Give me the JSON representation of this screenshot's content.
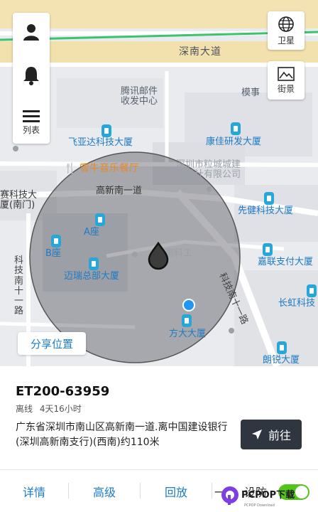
{
  "map": {
    "roads": {
      "shennan": "深南大道",
      "gaoxin": "高新南一道",
      "keji_left": "科技南十一路",
      "keji_right": "科技南十一路"
    },
    "labels": {
      "post": "腾讯邮件收发中心",
      "moshi": "模事",
      "feiyada": "飞亚达科技大厦",
      "kangjia": "康佳研发大厦",
      "restaurant": "雪牛音乐餐厅",
      "shenzhen_co": "深圳市粒城城建筑设计有限公司",
      "saike": "赛科技大厦(南门)",
      "xianjian": "先健科技大厦",
      "a_zuo": "A座",
      "b_zuo": "B座",
      "mairui": "迈瑞总部大厦",
      "jialian": "嘉联支付大厦",
      "changhong": "长虹科技",
      "fangda": "方大大厦",
      "langxin": "朗锐大厦",
      "center_gray": "南科工"
    },
    "controls": {
      "satellite": "卫星",
      "street": "街景",
      "list": "列表"
    },
    "share_label": "分享位置"
  },
  "device": {
    "name": "ET200-63959",
    "status": "离线",
    "duration": "4天16小时",
    "address": "广东省深圳市南山区高新南一道.离中国建设银行(深圳高新南支行)(西南)约110米",
    "goto_label": "前往"
  },
  "tabs": {
    "details": "详情",
    "advanced": "高级",
    "playback": "回放",
    "defense_partial": "一",
    "defense_tail": "设防"
  },
  "watermark": {
    "brand": "PCPOP下载",
    "sub": "PCPOP Download"
  },
  "colors": {
    "accent": "#1e7bc4",
    "go_button": "#2f3640",
    "toggle_on": "#52c41a"
  }
}
